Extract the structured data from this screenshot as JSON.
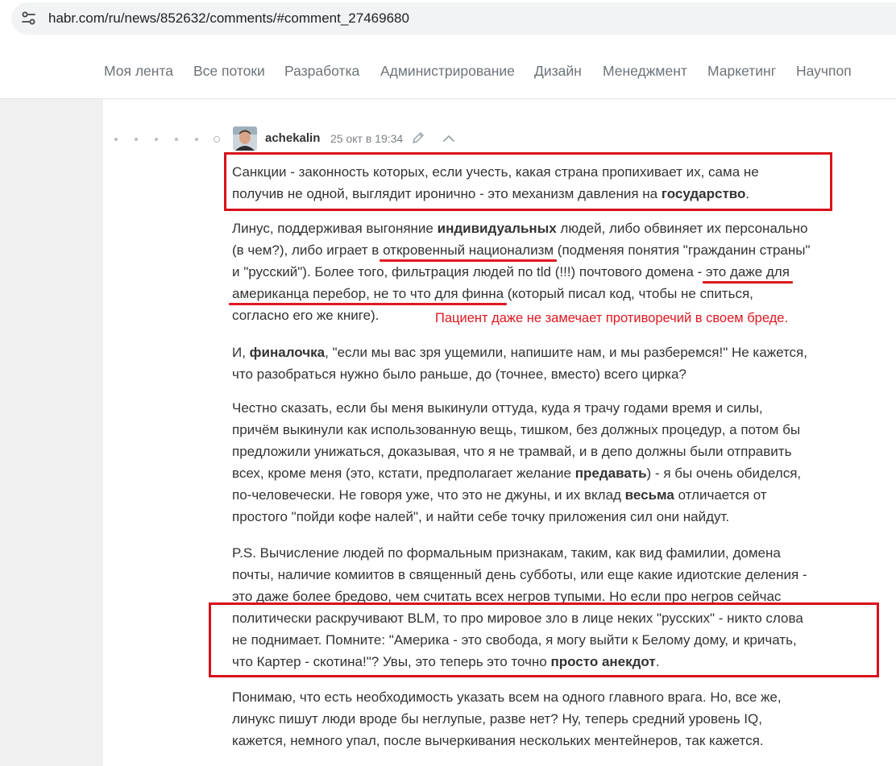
{
  "browser": {
    "url": "habr.com/ru/news/852632/comments/#comment_27469680",
    "site_info_icon": "tune-icon"
  },
  "nav": {
    "items": [
      "Моя лента",
      "Все потоки",
      "Разработка",
      "Администрирование",
      "Дизайн",
      "Менеджмент",
      "Маркетинг",
      "Научпоп"
    ]
  },
  "comment": {
    "author": "achekalin",
    "time": "25 окт в 19:34",
    "icons": {
      "edit": "pencil-icon",
      "parent": "chevron-up-icon"
    },
    "p1": {
      "l1": "Санкции - законность которых, если учесть, какая страна пропихивает их, сама не",
      "l2a": "получив не одной, выглядит иронично - это механизм давления на ",
      "l2b": "государство",
      "l2c": "."
    },
    "p2": {
      "l1a": "Линус, поддерживая выгоняние ",
      "l1b": "индивидуальных",
      "l1c": " людей, либо обвиняет их персонально",
      "l2": "(в чем?), либо играет в откровенный национализм (подменяя понятия \"гражданин страны\"",
      "l2a": "(в чем?), либо играет в ",
      "l2b": "откровенный национализм",
      "l2c": " (подменяя понятия \"гражданин страны\"",
      "l3a": "и \"русский\"). Более того, фильтрация людей по tld (!!!) почтового домена - ",
      "l3b": "это даже для",
      "l4a": "американца перебор, не то что для финна",
      "l4b": " (который писал код, чтобы не спиться,",
      "l5": "согласно его же книге)."
    },
    "annotation_note": "Пациент даже не замечает противоречий в своем бреде.",
    "p3": {
      "l1a": "И, ",
      "l1b": "финалочка",
      "l1c": ", \"если мы вас зря ущемили, напишите нам, и мы разберемся!\" Не кажется,",
      "l2": "что разобраться нужно было раньше, до (точнее, вместо) всего цирка?"
    },
    "p4": {
      "l1": "Честно сказать, если бы меня выкинули оттуда, куда я трачу годами время и силы,",
      "l2": "причём выкинули как использованную вещь, тишком, без должных процедур, а потом бы",
      "l3": "предложили унижаться, доказывая, что я не трамвай, и в депо должны были отправить",
      "l4a": "всех, кроме меня (это, кстати, предполагает желание ",
      "l4b": "предавать",
      "l4c": ") - я бы очень обиделся,",
      "l5a": "по-человечески. Не говоря уже, что это не джуны, и их вклад ",
      "l5b": "весьма",
      "l5c": " отличается от",
      "l6": "простого \"пойди кофе налей\", и найти себе точку приложения сил они найдут."
    },
    "p5": {
      "l1": "P.S. Вычисление людей по формальным признакам, таким, как вид фамилии, домена",
      "l2": "почты, наличие комиитов в священный день субботы, или еще какие идиотские деления -",
      "l3": "это даже более бредово, чем считать всех негров тупыми. Но если про негров сейчас",
      "l4": "политически раскручивают BLM, то про мировое зло в лице неких \"русских\" - никто слова",
      "l5": "не поднимает. Помните: \"Америка - это свобода, я могу выйти к Белому дому, и кричать,",
      "l6a": "что Картер - скотина!\"? Увы, это теперь это точно ",
      "l6b": "просто анекдот",
      "l6c": "."
    },
    "p6": {
      "l1": "Понимаю, что есть необходимость указать всем на одного главного врага. Но, все же,",
      "l2": "линукс пишут люди вроде бы неглупые, разве нет? Ну, теперь средний уровень IQ,",
      "l3": "кажется, немного упал, после вычеркивания нескольких ментейнеров, так кажется."
    }
  },
  "colors": {
    "annotation_red": "#d9101a",
    "nav_text": "#6d7378",
    "body_text": "#333333"
  }
}
